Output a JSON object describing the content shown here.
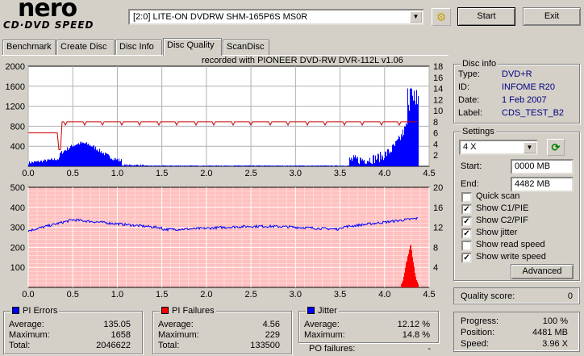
{
  "app": {
    "logo_text": "nero",
    "logo_subtext": "CD·DVD SPEED"
  },
  "toolbar": {
    "drive": "[2:0]  LITE-ON DVDRW SHM-165P6S MS0R",
    "start_label": "Start",
    "exit_label": "Exit"
  },
  "tabs": [
    {
      "label": "Benchmark",
      "active": false
    },
    {
      "label": "Create Disc",
      "active": false
    },
    {
      "label": "Disc Info",
      "active": false
    },
    {
      "label": "Disc Quality",
      "active": true
    },
    {
      "label": "ScanDisc",
      "active": false
    }
  ],
  "graph": {
    "recorded_with": "recorded with PIONEER DVD-RW  DVR-112L v1.06",
    "top": {
      "y_left_ticks": [
        "2000",
        "1600",
        "1200",
        "800",
        "400"
      ],
      "y_right_ticks": [
        "18",
        "16",
        "14",
        "12",
        "10",
        "8",
        "6",
        "4",
        "2"
      ],
      "x_ticks": [
        "0.0",
        "0.5",
        "1.0",
        "1.5",
        "2.0",
        "2.5",
        "3.0",
        "3.5",
        "4.0",
        "4.5"
      ]
    },
    "bottom": {
      "y_left_ticks": [
        "500",
        "400",
        "300",
        "200",
        "100"
      ],
      "y_right_ticks": [
        "20",
        "16",
        "12",
        "8",
        "4"
      ],
      "x_ticks": [
        "0.0",
        "0.5",
        "1.0",
        "1.5",
        "2.0",
        "2.5",
        "3.0",
        "3.5",
        "4.0",
        "4.5"
      ]
    },
    "colors": {
      "pie": "#0000ff",
      "pif": "#ff0000",
      "speed": "#cc0000",
      "jitter": "#0000ff",
      "bottom_bg": "#ffc0c0",
      "grid": "#ffffff"
    }
  },
  "pi_errors": {
    "title": "PI Errors",
    "color": "#0000ff",
    "average_label": "Average:",
    "average": "135.05",
    "maximum_label": "Maximum:",
    "maximum": "1658",
    "total_label": "Total:",
    "total": "2046622"
  },
  "pi_failures": {
    "title": "PI Failures",
    "color": "#ff0000",
    "average_label": "Average:",
    "average": "4.56",
    "maximum_label": "Maximum:",
    "maximum": "229",
    "total_label": "Total:",
    "total": "133500"
  },
  "jitter": {
    "title": "Jitter",
    "color": "#0000ff",
    "average_label": "Average:",
    "average": "12.12 %",
    "maximum_label": "Maximum:",
    "maximum": "14.8 %",
    "po_label": "PO failures:",
    "po": "-"
  },
  "disc_info": {
    "title": "Disc info",
    "type_label": "Type:",
    "type": "DVD+R",
    "id_label": "ID:",
    "id": "INFOME R20",
    "date_label": "Date:",
    "date": "1 Feb 2007",
    "label_label": "Label:",
    "label": "CDS_TEST_B2"
  },
  "settings": {
    "title": "Settings",
    "speed": "4 X",
    "start_label": "Start:",
    "start_value": "0000 MB",
    "end_label": "End:",
    "end_value": "4482 MB",
    "checks": [
      {
        "label": "Quick scan",
        "checked": false
      },
      {
        "label": "Show C1/PIE",
        "checked": true
      },
      {
        "label": "Show C2/PIF",
        "checked": true
      },
      {
        "label": "Show jitter",
        "checked": true
      },
      {
        "label": "Show read speed",
        "checked": false
      },
      {
        "label": "Show write speed",
        "checked": true
      }
    ],
    "advanced_label": "Advanced"
  },
  "quality": {
    "label": "Quality score:",
    "value": "0"
  },
  "progress": {
    "progress_label": "Progress:",
    "progress_value": "100 %",
    "position_label": "Position:",
    "position_value": "4481 MB",
    "speed_label": "Speed:",
    "speed_value": "3.96 X"
  }
}
